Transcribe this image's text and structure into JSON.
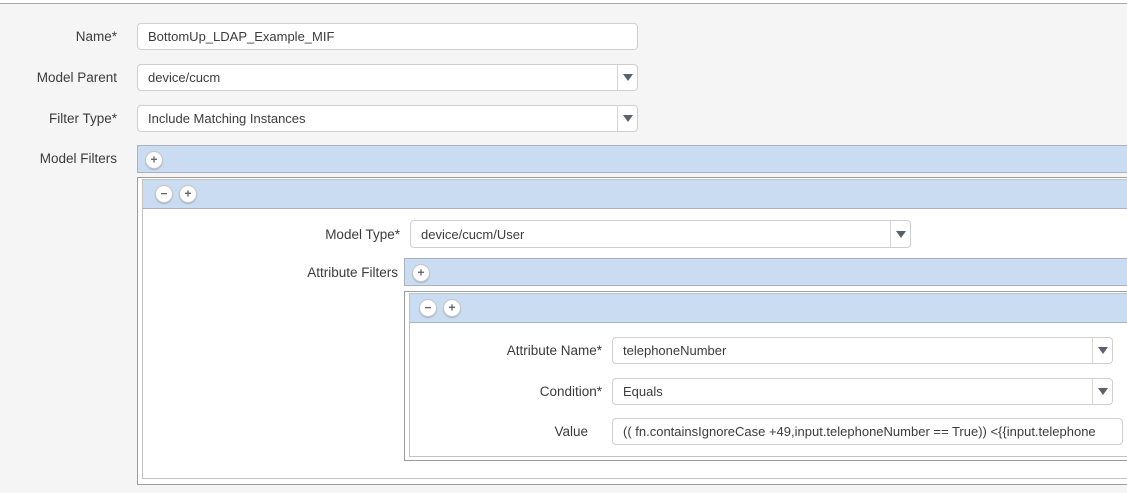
{
  "colors": {
    "accent_bar": "#c9dcf1",
    "panel_border": "#9c9c9c",
    "page_background": "#f5f5f6"
  },
  "controls": {
    "add": "+",
    "remove": "−"
  },
  "form": {
    "name": {
      "label": "Name*",
      "value": "BottomUp_LDAP_Example_MIF"
    },
    "model_parent": {
      "label": "Model Parent",
      "value": "device/cucm"
    },
    "filter_type": {
      "label": "Filter Type*",
      "value": "Include Matching Instances"
    },
    "model_filters": {
      "label": "Model Filters",
      "item": {
        "model_type": {
          "label": "Model Type*",
          "value": "device/cucm/User"
        },
        "attribute_filters": {
          "label": "Attribute Filters",
          "item": {
            "attribute_name": {
              "label": "Attribute Name*",
              "value": "telephoneNumber"
            },
            "condition": {
              "label": "Condition*",
              "value": "Equals"
            },
            "value": {
              "label": "Value",
              "value": "(( fn.containsIgnoreCase +49,input.telephoneNumber == True)) <{{input.telephone"
            }
          }
        }
      }
    }
  }
}
